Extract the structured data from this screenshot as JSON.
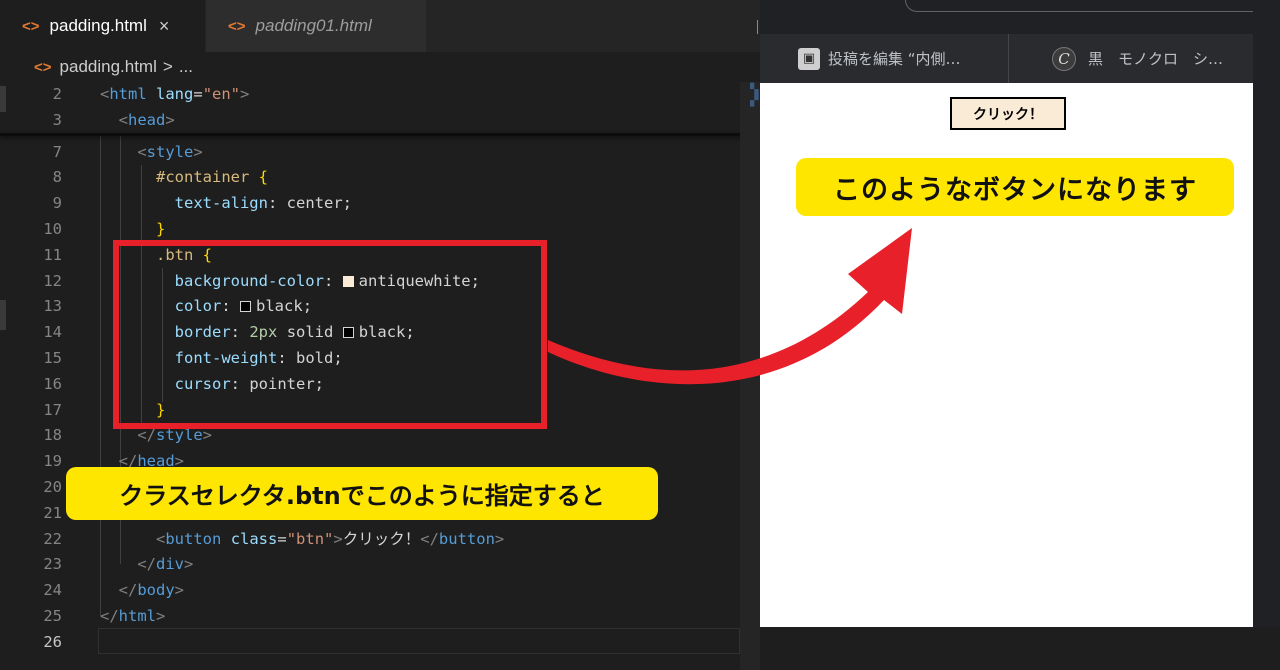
{
  "editor": {
    "tabs": [
      {
        "label": "padding.html",
        "close": "×",
        "icon": "<>"
      },
      {
        "label": "padding01.html",
        "icon": "<>"
      }
    ],
    "breadcrumb": {
      "icon": "<>",
      "file": "padding.html",
      "sep": ">",
      "rest": "..."
    },
    "line_numbers": [
      "2",
      "3",
      "7",
      "8",
      "9",
      "10",
      "11",
      "12",
      "13",
      "14",
      "15",
      "16",
      "17",
      "18",
      "19",
      "20",
      "21",
      "22",
      "23",
      "24",
      "25",
      "26"
    ],
    "code": {
      "l2": {
        "open": "<",
        "tag": "html",
        "attr": "lang",
        "eq": "=",
        "val": "\"en\"",
        "close": ">"
      },
      "l3": {
        "open": "<",
        "tag": "head",
        "close": ">"
      },
      "l7": {
        "open": "<",
        "tag": "style",
        "close": ">"
      },
      "l8": {
        "selector": "#container",
        "brace": "{"
      },
      "l9": {
        "prop": "text-align",
        "colon": ":",
        "value": "center",
        "semi": ";"
      },
      "l10": {
        "brace": "}"
      },
      "l11": {
        "selector": ".btn",
        "brace": "{"
      },
      "l12": {
        "prop": "background-color",
        "colon": ":",
        "value": "antiquewhite",
        "semi": ";"
      },
      "l13": {
        "prop": "color",
        "colon": ":",
        "value": "black",
        "semi": ";"
      },
      "l14": {
        "prop": "border",
        "colon": ":",
        "num": "2px",
        "kw": "solid",
        "value": "black",
        "semi": ";"
      },
      "l15": {
        "prop": "font-weight",
        "colon": ":",
        "value": "bold",
        "semi": ";"
      },
      "l16": {
        "prop": "cursor",
        "colon": ":",
        "value": "pointer",
        "semi": ";"
      },
      "l17": {
        "brace": "}"
      },
      "l18": {
        "open": "</",
        "tag": "style",
        "close": ">"
      },
      "l19": {
        "open": "</",
        "tag": "head",
        "close": ">"
      },
      "l22": {
        "open": "<",
        "tag": "button",
        "attr": "class",
        "eq": "=",
        "val": "\"btn\"",
        "close": ">",
        "text": "クリック！",
        "close_open": "</",
        "close_tag": "button",
        "close_close": ">"
      },
      "l23": {
        "open": "</",
        "tag": "div",
        "close": ">"
      },
      "l24": {
        "open": "</",
        "tag": "body",
        "close": ">"
      },
      "l25": {
        "open": "</",
        "tag": "html",
        "close": ">"
      }
    },
    "swatch_colors": {
      "antiquewhite": "#faebd7",
      "black": "#000000"
    }
  },
  "browser": {
    "bookmarks": [
      {
        "label": "投稿を編集 “内側…",
        "icon": "bookmark-favicon"
      },
      {
        "label": "黒　モノクロ　シ…",
        "icon": "c-logo-icon",
        "icon_char": "C"
      }
    ],
    "demo_button": "クリック！"
  },
  "annotations": {
    "callout_right": "このようなボタンになります",
    "callout_left": "クラスセレクタ.btnでこのように指定すると",
    "highlight_color": "#ffe600",
    "arrow_color": "#e8202a"
  }
}
